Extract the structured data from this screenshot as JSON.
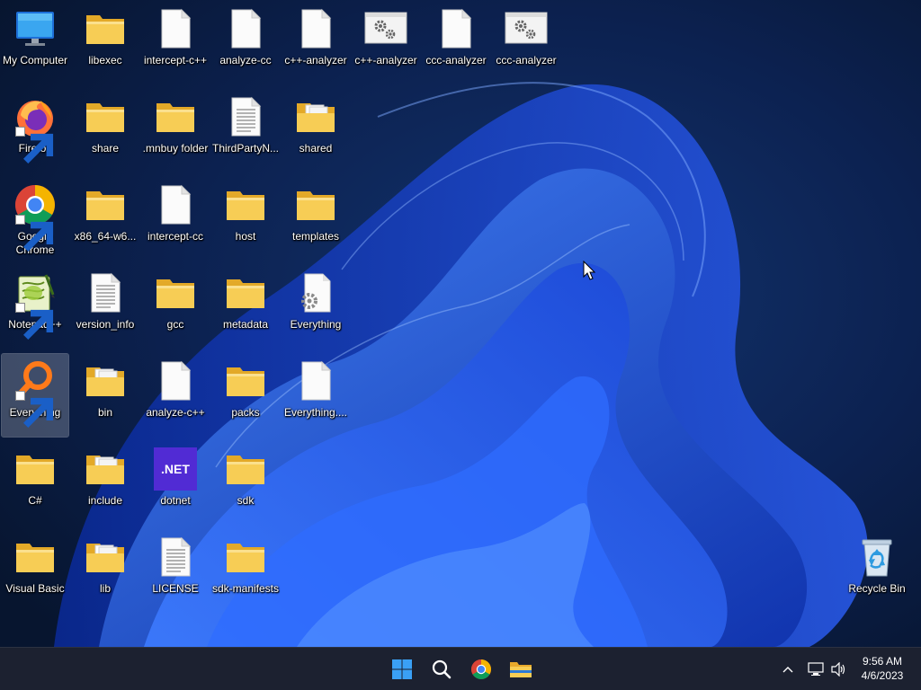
{
  "desktop": {
    "icons": [
      {
        "label": "My Computer",
        "type": "computer"
      },
      {
        "label": "libexec",
        "type": "folder"
      },
      {
        "label": "intercept-c++",
        "type": "file"
      },
      {
        "label": "analyze-cc",
        "type": "file"
      },
      {
        "label": "c++-analyzer",
        "type": "file"
      },
      {
        "label": "c++-analyzer",
        "type": "app-gear"
      },
      {
        "label": "ccc-analyzer",
        "type": "file"
      },
      {
        "label": "ccc-analyzer",
        "type": "app-gear"
      },
      {
        "label": "Firefox",
        "type": "firefox",
        "shortcut": true
      },
      {
        "label": "share",
        "type": "folder"
      },
      {
        "label": ".mnbuy folder",
        "type": "folder"
      },
      {
        "label": "ThirdPartyN...",
        "type": "textfile"
      },
      {
        "label": "shared",
        "type": "folder-docs"
      },
      {
        "label": "Google Chrome",
        "type": "chrome",
        "shortcut": true
      },
      {
        "label": "x86_64-w6...",
        "type": "folder"
      },
      {
        "label": "intercept-cc",
        "type": "file"
      },
      {
        "label": "host",
        "type": "folder"
      },
      {
        "label": "templates",
        "type": "folder"
      },
      {
        "label": "Notepad++",
        "type": "notepadpp",
        "shortcut": true
      },
      {
        "label": "version_info",
        "type": "textfile"
      },
      {
        "label": "gcc",
        "type": "folder"
      },
      {
        "label": "metadata",
        "type": "folder"
      },
      {
        "label": "Everything",
        "type": "file-gear"
      },
      {
        "label": "Everything",
        "type": "everything",
        "shortcut": true,
        "selected": true
      },
      {
        "label": "bin",
        "type": "folder-docs"
      },
      {
        "label": "analyze-c++",
        "type": "file"
      },
      {
        "label": "packs",
        "type": "folder"
      },
      {
        "label": "Everything....",
        "type": "file"
      },
      {
        "label": "C#",
        "type": "folder"
      },
      {
        "label": "include",
        "type": "folder-docs"
      },
      {
        "label": "dotnet",
        "type": "dotnet",
        "badge": ".NET"
      },
      {
        "label": "sdk",
        "type": "folder"
      },
      {
        "label": "Visual Basic",
        "type": "folder"
      },
      {
        "label": "lib",
        "type": "folder-docs"
      },
      {
        "label": "LICENSE",
        "type": "textfile"
      },
      {
        "label": "sdk-manifests",
        "type": "folder"
      },
      {
        "label": "Recycle Bin",
        "type": "recycle"
      }
    ]
  },
  "taskbar": {
    "pinned": [
      "windows-start-icon",
      "search-icon",
      "chrome-icon",
      "file-explorer-icon"
    ],
    "clock_time": "9:56 AM",
    "clock_date": "4/6/2023"
  },
  "colors": {
    "taskbar_bg": "#1c2130",
    "wallpaper_accent": "#1f4fe0",
    "folder_yellow": "#f7cd55",
    "dotnet_purple": "#512bd4"
  }
}
